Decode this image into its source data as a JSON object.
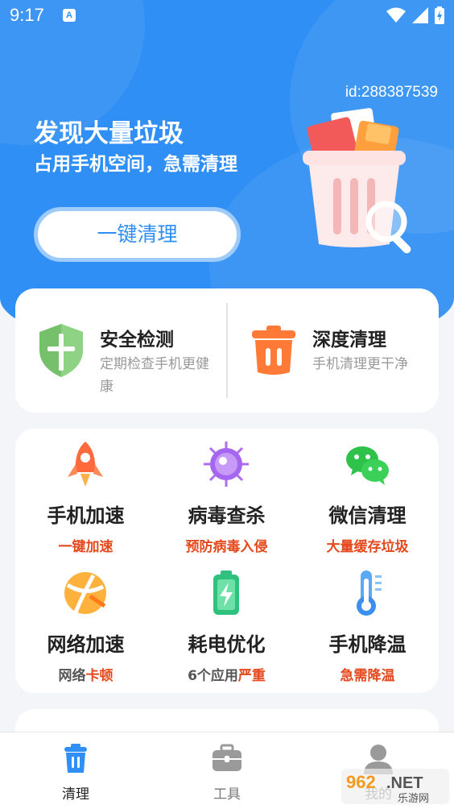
{
  "status_bar": {
    "time": "9:17",
    "notif_badge": "A"
  },
  "header": {
    "user_id": "id:288387539",
    "title": "发现大量垃圾",
    "subtitle": "占用手机空间，急需清理",
    "clean_button": "一键清理"
  },
  "features": [
    {
      "title": "安全检测",
      "desc": "定期检查手机更健康",
      "icon": "shield-icon"
    },
    {
      "title": "深度清理",
      "desc": "手机清理更干净",
      "icon": "trash-icon"
    }
  ],
  "tools": [
    {
      "name": "手机加速",
      "sub_plain": "",
      "sub_red": "一键加速",
      "icon": "rocket-icon"
    },
    {
      "name": "病毒查杀",
      "sub_plain": "",
      "sub_red": "预防病毒入侵",
      "icon": "virus-icon"
    },
    {
      "name": "微信清理",
      "sub_plain": "",
      "sub_red": "大量缓存垃圾",
      "icon": "wechat-icon"
    },
    {
      "name": "网络加速",
      "sub_plain": "网络",
      "sub_red": "卡顿",
      "icon": "network-icon"
    },
    {
      "name": "耗电优化",
      "sub_plain": "6个应用",
      "sub_red": "严重",
      "icon": "battery-icon"
    },
    {
      "name": "手机降温",
      "sub_plain": "",
      "sub_red": "急需降温",
      "icon": "thermometer-icon"
    }
  ],
  "bottom_nav": [
    {
      "label": "清理",
      "icon": "clean-bin-icon",
      "active": true
    },
    {
      "label": "工具",
      "icon": "toolbox-icon",
      "active": false
    },
    {
      "label": "我的",
      "icon": "profile-icon",
      "active": false
    }
  ],
  "watermark": {
    "text": "962.NET",
    "sub": "乐游网"
  },
  "colors": {
    "primary": "#2f8ff4",
    "accent_red": "#e4491d",
    "background": "#f3f5f9"
  }
}
